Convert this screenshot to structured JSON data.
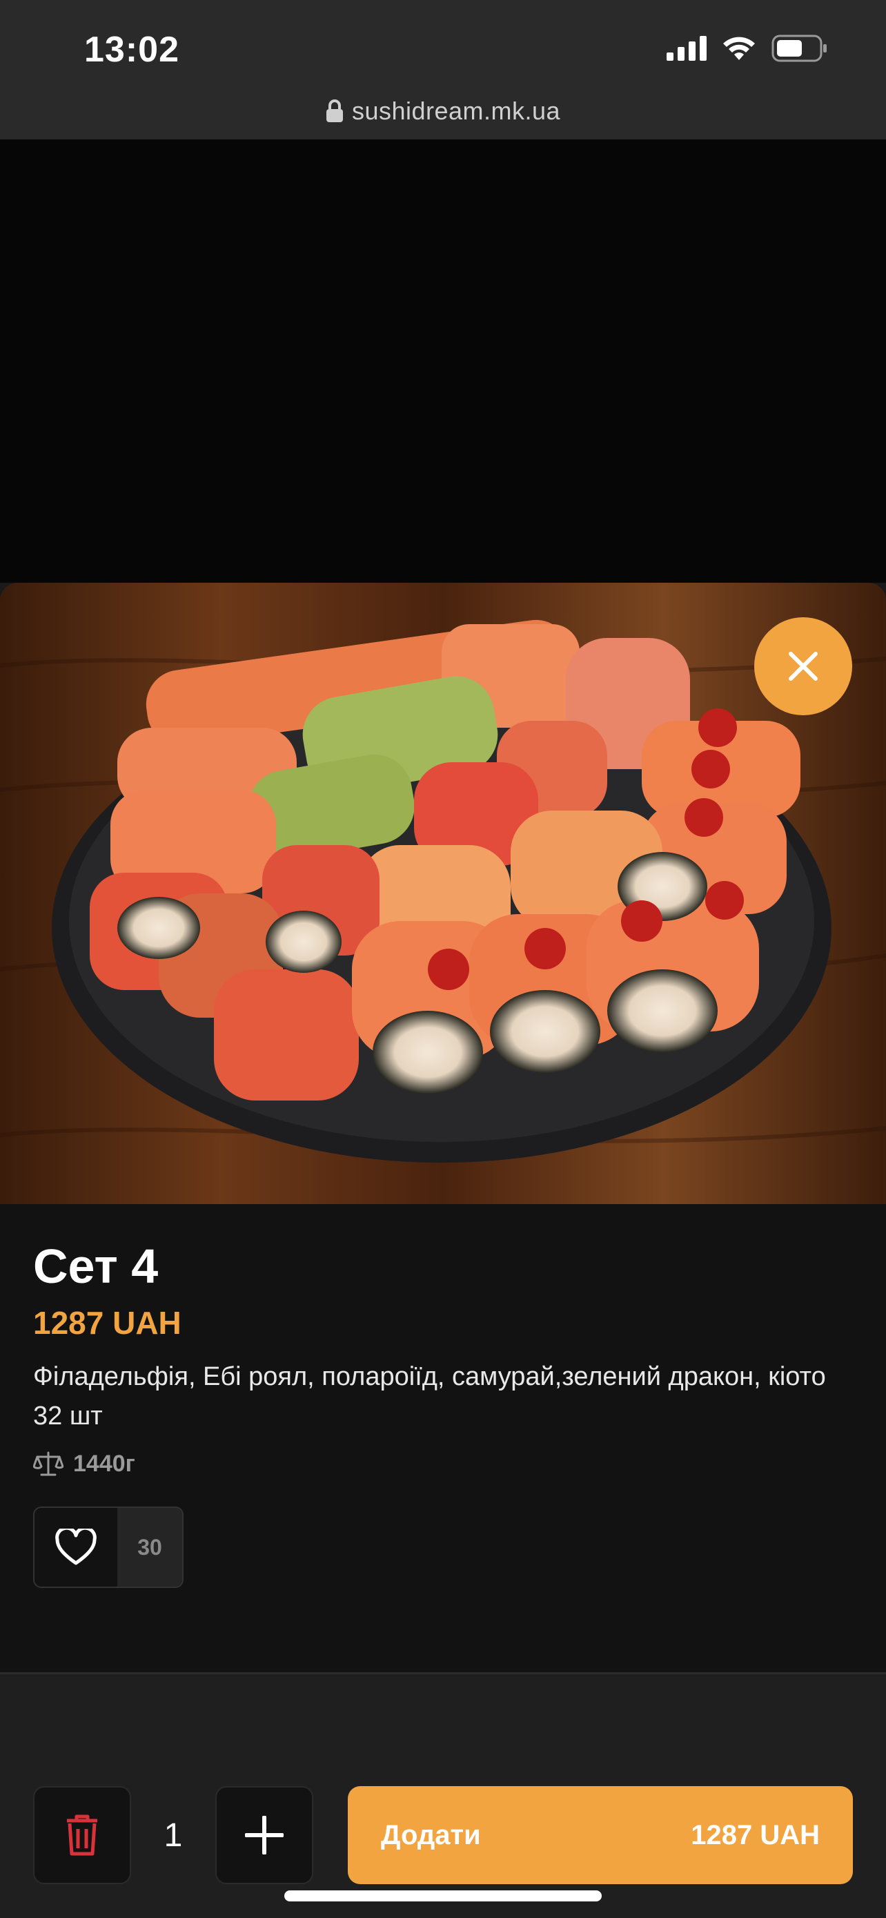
{
  "status_bar": {
    "time": "13:02"
  },
  "browser": {
    "url": "sushidream.mk.ua"
  },
  "product": {
    "title": "Сет 4",
    "price": "1287 UAH",
    "description": "Філадельфія, Ебі роял,  полароіїд, самурай,зелений дракон, кіото",
    "pieces": "32 шт",
    "weight": "1440г",
    "image_icon": "sushi-set-photo"
  },
  "favorites": {
    "count": "30",
    "icon": "heart-icon"
  },
  "cart": {
    "quantity": "1",
    "add_label": "Додати",
    "add_price": "1287 UAH"
  },
  "colors": {
    "accent": "#f2a440",
    "background": "#121212",
    "delete": "#d9323a"
  }
}
